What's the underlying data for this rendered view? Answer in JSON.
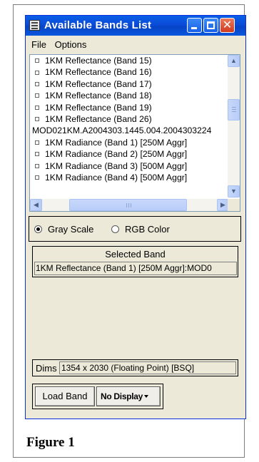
{
  "window": {
    "title": "Available Bands List"
  },
  "menu": {
    "items": [
      "File",
      "Options"
    ]
  },
  "band_list": {
    "rows": [
      {
        "text": "1KM Reflectance (Band 15)",
        "type": "band"
      },
      {
        "text": "1KM Reflectance (Band 16)",
        "type": "band"
      },
      {
        "text": "1KM Reflectance (Band 17)",
        "type": "band"
      },
      {
        "text": "1KM Reflectance (Band 18)",
        "type": "band"
      },
      {
        "text": "1KM Reflectance (Band 19)",
        "type": "band"
      },
      {
        "text": "1KM Reflectance (Band 26)",
        "type": "band"
      },
      {
        "text": "MOD021KM.A2004303.1445.004.2004303224",
        "type": "file"
      },
      {
        "text": "1KM Radiance (Band 1) [250M Aggr]",
        "type": "band"
      },
      {
        "text": "1KM Radiance (Band 2) [250M Aggr]",
        "type": "band"
      },
      {
        "text": "1KM Radiance (Band 3) [500M Aggr]",
        "type": "band"
      },
      {
        "text": "1KM Radiance (Band 4) [500M Aggr]",
        "type": "band"
      }
    ]
  },
  "mode": {
    "gray_label": "Gray Scale",
    "rgb_label": "RGB Color",
    "selected": "gray"
  },
  "selected_band": {
    "title": "Selected Band",
    "value": "1KM Reflectance (Band 1) [250M Aggr]:MOD0"
  },
  "dims": {
    "label": "Dims",
    "value": "1354 x 2030 (Floating Point) [BSQ]"
  },
  "actions": {
    "load_label": "Load Band",
    "display_label": "No Display"
  },
  "caption": "Figure 1"
}
